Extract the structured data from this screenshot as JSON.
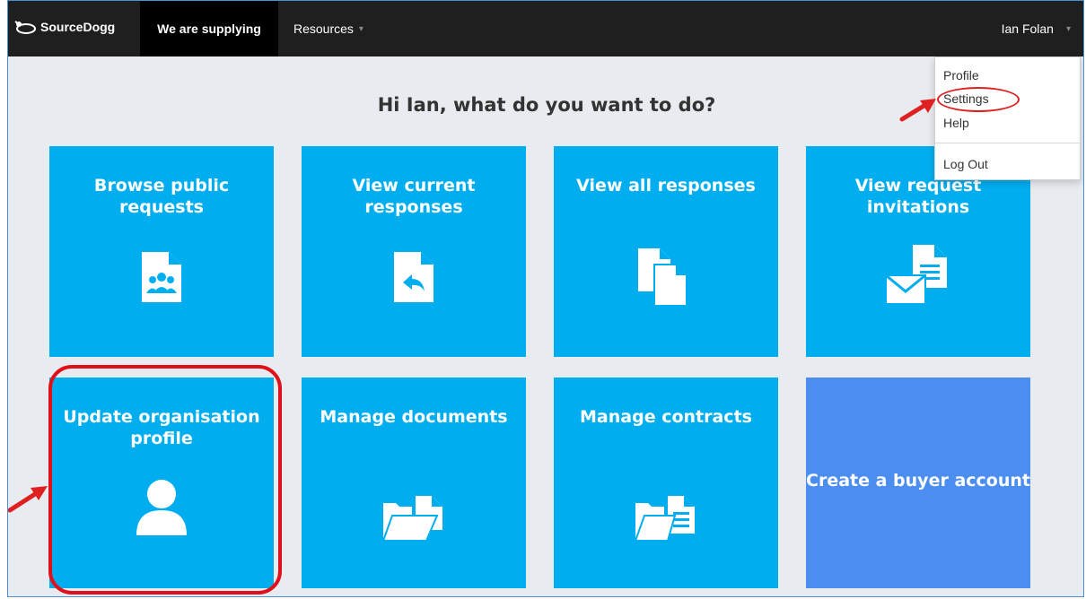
{
  "navbar": {
    "brand": "SourceDogg",
    "active_tab": "We are supplying",
    "resources_menu": "Resources",
    "user_name": "Ian Folan"
  },
  "greeting": "Hi Ian, what do you want to do?",
  "tiles": [
    {
      "title": "Browse public requests",
      "icon": "document-users-icon"
    },
    {
      "title": "View current responses",
      "icon": "document-reply-icon"
    },
    {
      "title": "View all responses",
      "icon": "documents-icon"
    },
    {
      "title": "View request invitations",
      "icon": "envelope-document-icon"
    },
    {
      "title": "Update organisation profile",
      "icon": "user-icon"
    },
    {
      "title": "Manage documents",
      "icon": "folder-document-icon"
    },
    {
      "title": "Manage contracts",
      "icon": "folder-contract-icon"
    },
    {
      "title": "Create a buyer account",
      "icon": ""
    }
  ],
  "user_menu": {
    "items": [
      "Profile",
      "Settings",
      "Help",
      "Log Out"
    ]
  },
  "colors": {
    "navbar": "#1f1f1f",
    "tile": "#00aeef",
    "buyer_tile": "#4b8ef0",
    "annotation": "#e02020",
    "background": "#e8ebef"
  }
}
